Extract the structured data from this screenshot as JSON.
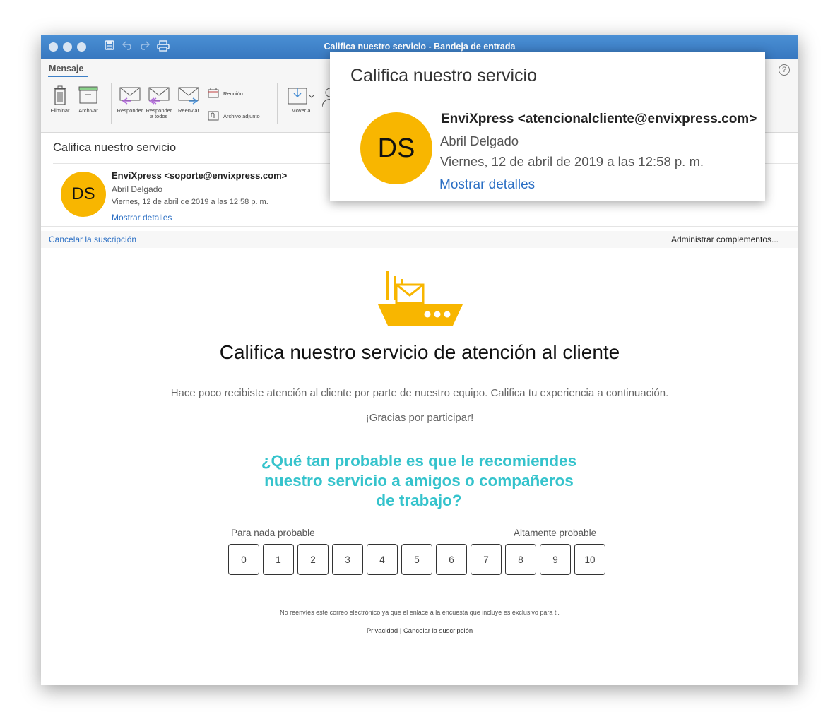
{
  "window": {
    "title": "Califica nuestro servicio - Bandeja de entrada"
  },
  "ribbon": {
    "tab": "Mensaje",
    "buttons": {
      "delete": "Eliminar",
      "archive": "Archivar",
      "reply": "Responder",
      "reply_all_1": "Responder",
      "reply_all_2": "a todos",
      "forward": "Reenviar",
      "meeting": "Reunión",
      "attachment": "Archivo adjunto",
      "move": "Mover a"
    }
  },
  "message": {
    "subject": "Califica nuestro servicio",
    "avatar_initials": "DS",
    "sender": "EnviXpress <soporte@envixpress.com>",
    "to": "Abril Delgado",
    "date": "Viernes, 12 de abril de 2019 a las 12:58 p. m.",
    "details_link": "Mostrar detalles"
  },
  "infobar": {
    "unsubscribe": "Cancelar la suscripción",
    "addins": "Administrar complementos..."
  },
  "email_body": {
    "title": "Califica nuestro servicio de atención al cliente",
    "paragraph1": "Hace poco recibiste atención al cliente por parte de nuestro equipo. Califica tu experiencia a continuación.",
    "paragraph2": "¡Gracias por participar!",
    "question_line1": "¿Qué tan probable es que le recomiendes",
    "question_line2": "nuestro servicio a amigos o compañeros",
    "question_line3": "de trabajo?",
    "scale_low": "Para nada probable",
    "scale_high": "Altamente probable",
    "scores": [
      "0",
      "1",
      "2",
      "3",
      "4",
      "5",
      "6",
      "7",
      "8",
      "9",
      "10"
    ],
    "footer_note": "No reenvíes este correo electrónico ya que el enlace a la encuesta que incluye es exclusivo para ti.",
    "privacy": "Privacidad",
    "separator": "|",
    "footer_unsubscribe": "Cancelar la suscripción"
  },
  "zoom": {
    "subject": "Califica nuestro servicio",
    "avatar_initials": "DS",
    "sender": "EnviXpress <atencionalcliente@envixpress.com>",
    "to": "Abril Delgado",
    "date": "Viernes, 12 de abril de 2019 a las 12:58 p. m.",
    "details_link": "Mostrar detalles"
  },
  "colors": {
    "titlebar": "#3e82c9",
    "avatar": "#f8b600",
    "link": "#2b6fc4",
    "question": "#35c3cc",
    "ship": "#f8b600"
  }
}
